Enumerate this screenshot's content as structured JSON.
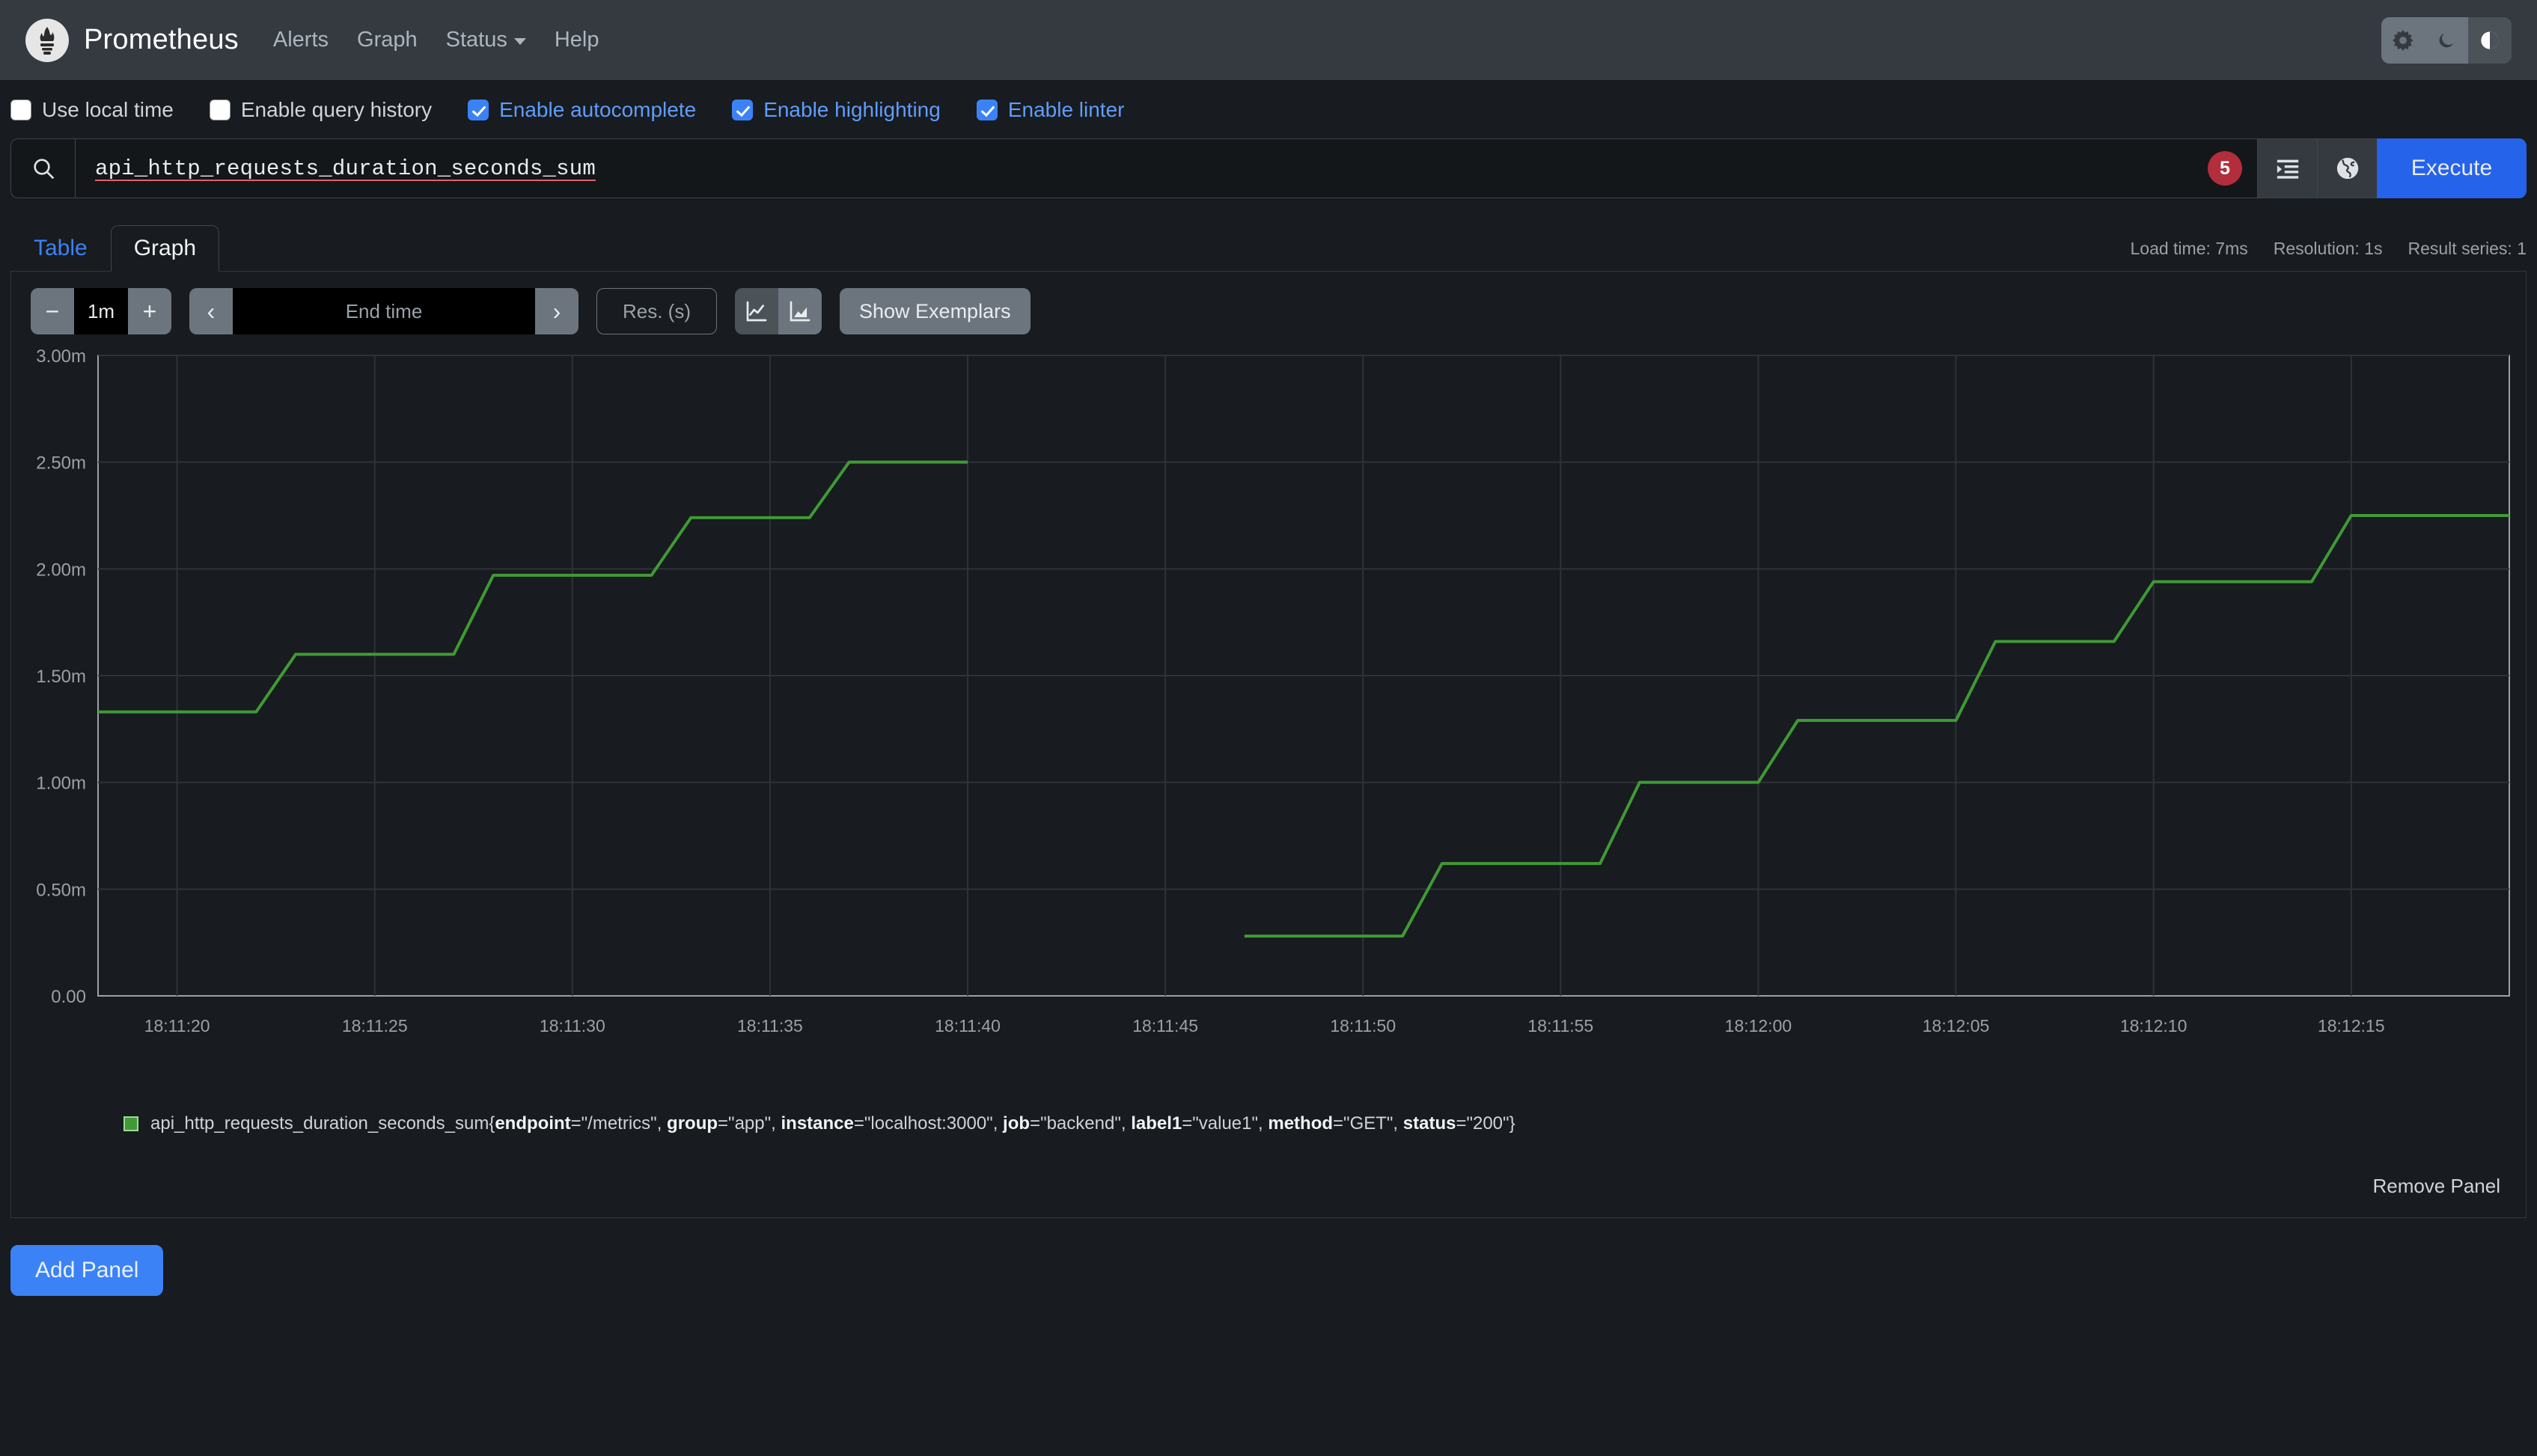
{
  "navbar": {
    "brand": "Prometheus",
    "logo_icon": "prometheus-torch-icon",
    "links": [
      {
        "label": "Alerts",
        "name": "alerts"
      },
      {
        "label": "Graph",
        "name": "graph"
      },
      {
        "label": "Status",
        "name": "status",
        "caret": true
      },
      {
        "label": "Help",
        "name": "help"
      }
    ],
    "theme": {
      "light_icon": "sun-icon",
      "dark_icon": "moon-icon",
      "auto_icon": "half-circle-icon",
      "selected": "auto"
    }
  },
  "options": [
    {
      "label": "Use local time",
      "checked": false,
      "name": "use-local-time"
    },
    {
      "label": "Enable query history",
      "checked": false,
      "name": "enable-query-history"
    },
    {
      "label": "Enable autocomplete",
      "checked": true,
      "name": "enable-autocomplete"
    },
    {
      "label": "Enable highlighting",
      "checked": true,
      "name": "enable-highlighting"
    },
    {
      "label": "Enable linter",
      "checked": true,
      "name": "enable-linter"
    }
  ],
  "query": {
    "search_icon": "search-icon",
    "text": "api_http_requests_duration_seconds_sum",
    "tokens": [
      "api_",
      "http_",
      "requests_",
      "duration_",
      "seconds_",
      "sum"
    ],
    "badge_count": "5",
    "format_icon": "format-indent-icon",
    "globe_icon": "globe-icon",
    "execute_label": "Execute"
  },
  "tabs": [
    {
      "label": "Table",
      "active": false,
      "name": "tab-table"
    },
    {
      "label": "Graph",
      "active": true,
      "name": "tab-graph"
    }
  ],
  "stats": {
    "load_time": "Load time: 7ms",
    "resolution": "Resolution: 1s",
    "result_series": "Result series: 1"
  },
  "controls": {
    "range_minus": "−",
    "range_value": "1m",
    "range_plus": "+",
    "prev_icon": "‹",
    "end_time_placeholder": "End time",
    "next_icon": "›",
    "resolution_placeholder": "Res. (s)",
    "line_chart_icon": "line-chart-icon",
    "stacked_chart_icon": "stacked-area-chart-icon",
    "chart_type_selected": "line",
    "exemplars_label": "Show Exemplars"
  },
  "legend": {
    "metric": "api_http_requests_duration_seconds_sum{",
    "labels": [
      {
        "key": "endpoint",
        "value": "\"/metrics\""
      },
      {
        "key": "group",
        "value": "\"app\""
      },
      {
        "key": "instance",
        "value": "\"localhost:3000\""
      },
      {
        "key": "job",
        "value": "\"backend\""
      },
      {
        "key": "label1",
        "value": "\"value1\""
      },
      {
        "key": "method",
        "value": "\"GET\""
      },
      {
        "key": "status",
        "value": "\"200\""
      }
    ],
    "close": "}",
    "color": "#3f9a35"
  },
  "footer": {
    "remove_panel": "Remove Panel",
    "add_panel": "Add Panel"
  },
  "chart_data": {
    "type": "line",
    "title": "",
    "xlabel": "",
    "ylabel": "",
    "grid": true,
    "legend_position": "bottom",
    "line_color": "#3f9a35",
    "ylim": [
      0,
      0.003
    ],
    "ytick_labels": [
      "0.00",
      "0.50m",
      "1.00m",
      "1.50m",
      "2.00m",
      "2.50m",
      "3.00m"
    ],
    "ytick_values": [
      0,
      0.0005,
      0.001,
      0.0015,
      0.002,
      0.0025,
      0.003
    ],
    "xtick_labels": [
      "18:11:20",
      "18:11:25",
      "18:11:30",
      "18:11:35",
      "18:11:40",
      "18:11:45",
      "18:11:50",
      "18:11:55",
      "18:12:00",
      "18:12:05",
      "18:12:10",
      "18:12:15"
    ],
    "xlim": [
      "18:11:18",
      "18:12:19"
    ],
    "series": [
      {
        "name": "api_http_requests_duration_seconds_sum{endpoint=\"/metrics\", group=\"app\", instance=\"localhost:3000\", job=\"backend\", label1=\"value1\", method=\"GET\", status=\"200\"}",
        "segments": [
          {
            "x": [
              "18:11:18",
              "18:11:22",
              "18:11:23",
              "18:11:27",
              "18:11:28",
              "18:11:32",
              "18:11:33",
              "18:11:36",
              "18:11:37",
              "18:11:40"
            ],
            "y": [
              0.00133,
              0.00133,
              0.0016,
              0.0016,
              0.00197,
              0.00197,
              0.00224,
              0.00224,
              0.0025,
              0.0025
            ]
          },
          {
            "x": [
              "18:11:47",
              "18:11:51",
              "18:11:52",
              "18:11:56",
              "18:11:57",
              "18:12:00",
              "18:12:01",
              "18:12:05",
              "18:12:06",
              "18:12:09",
              "18:12:10",
              "18:12:14",
              "18:12:15",
              "18:12:19"
            ],
            "y": [
              0.00028,
              0.00028,
              0.00062,
              0.00062,
              0.001,
              0.001,
              0.00129,
              0.00129,
              0.00166,
              0.00166,
              0.00194,
              0.00194,
              0.00225,
              0.00225
            ]
          }
        ]
      }
    ]
  }
}
